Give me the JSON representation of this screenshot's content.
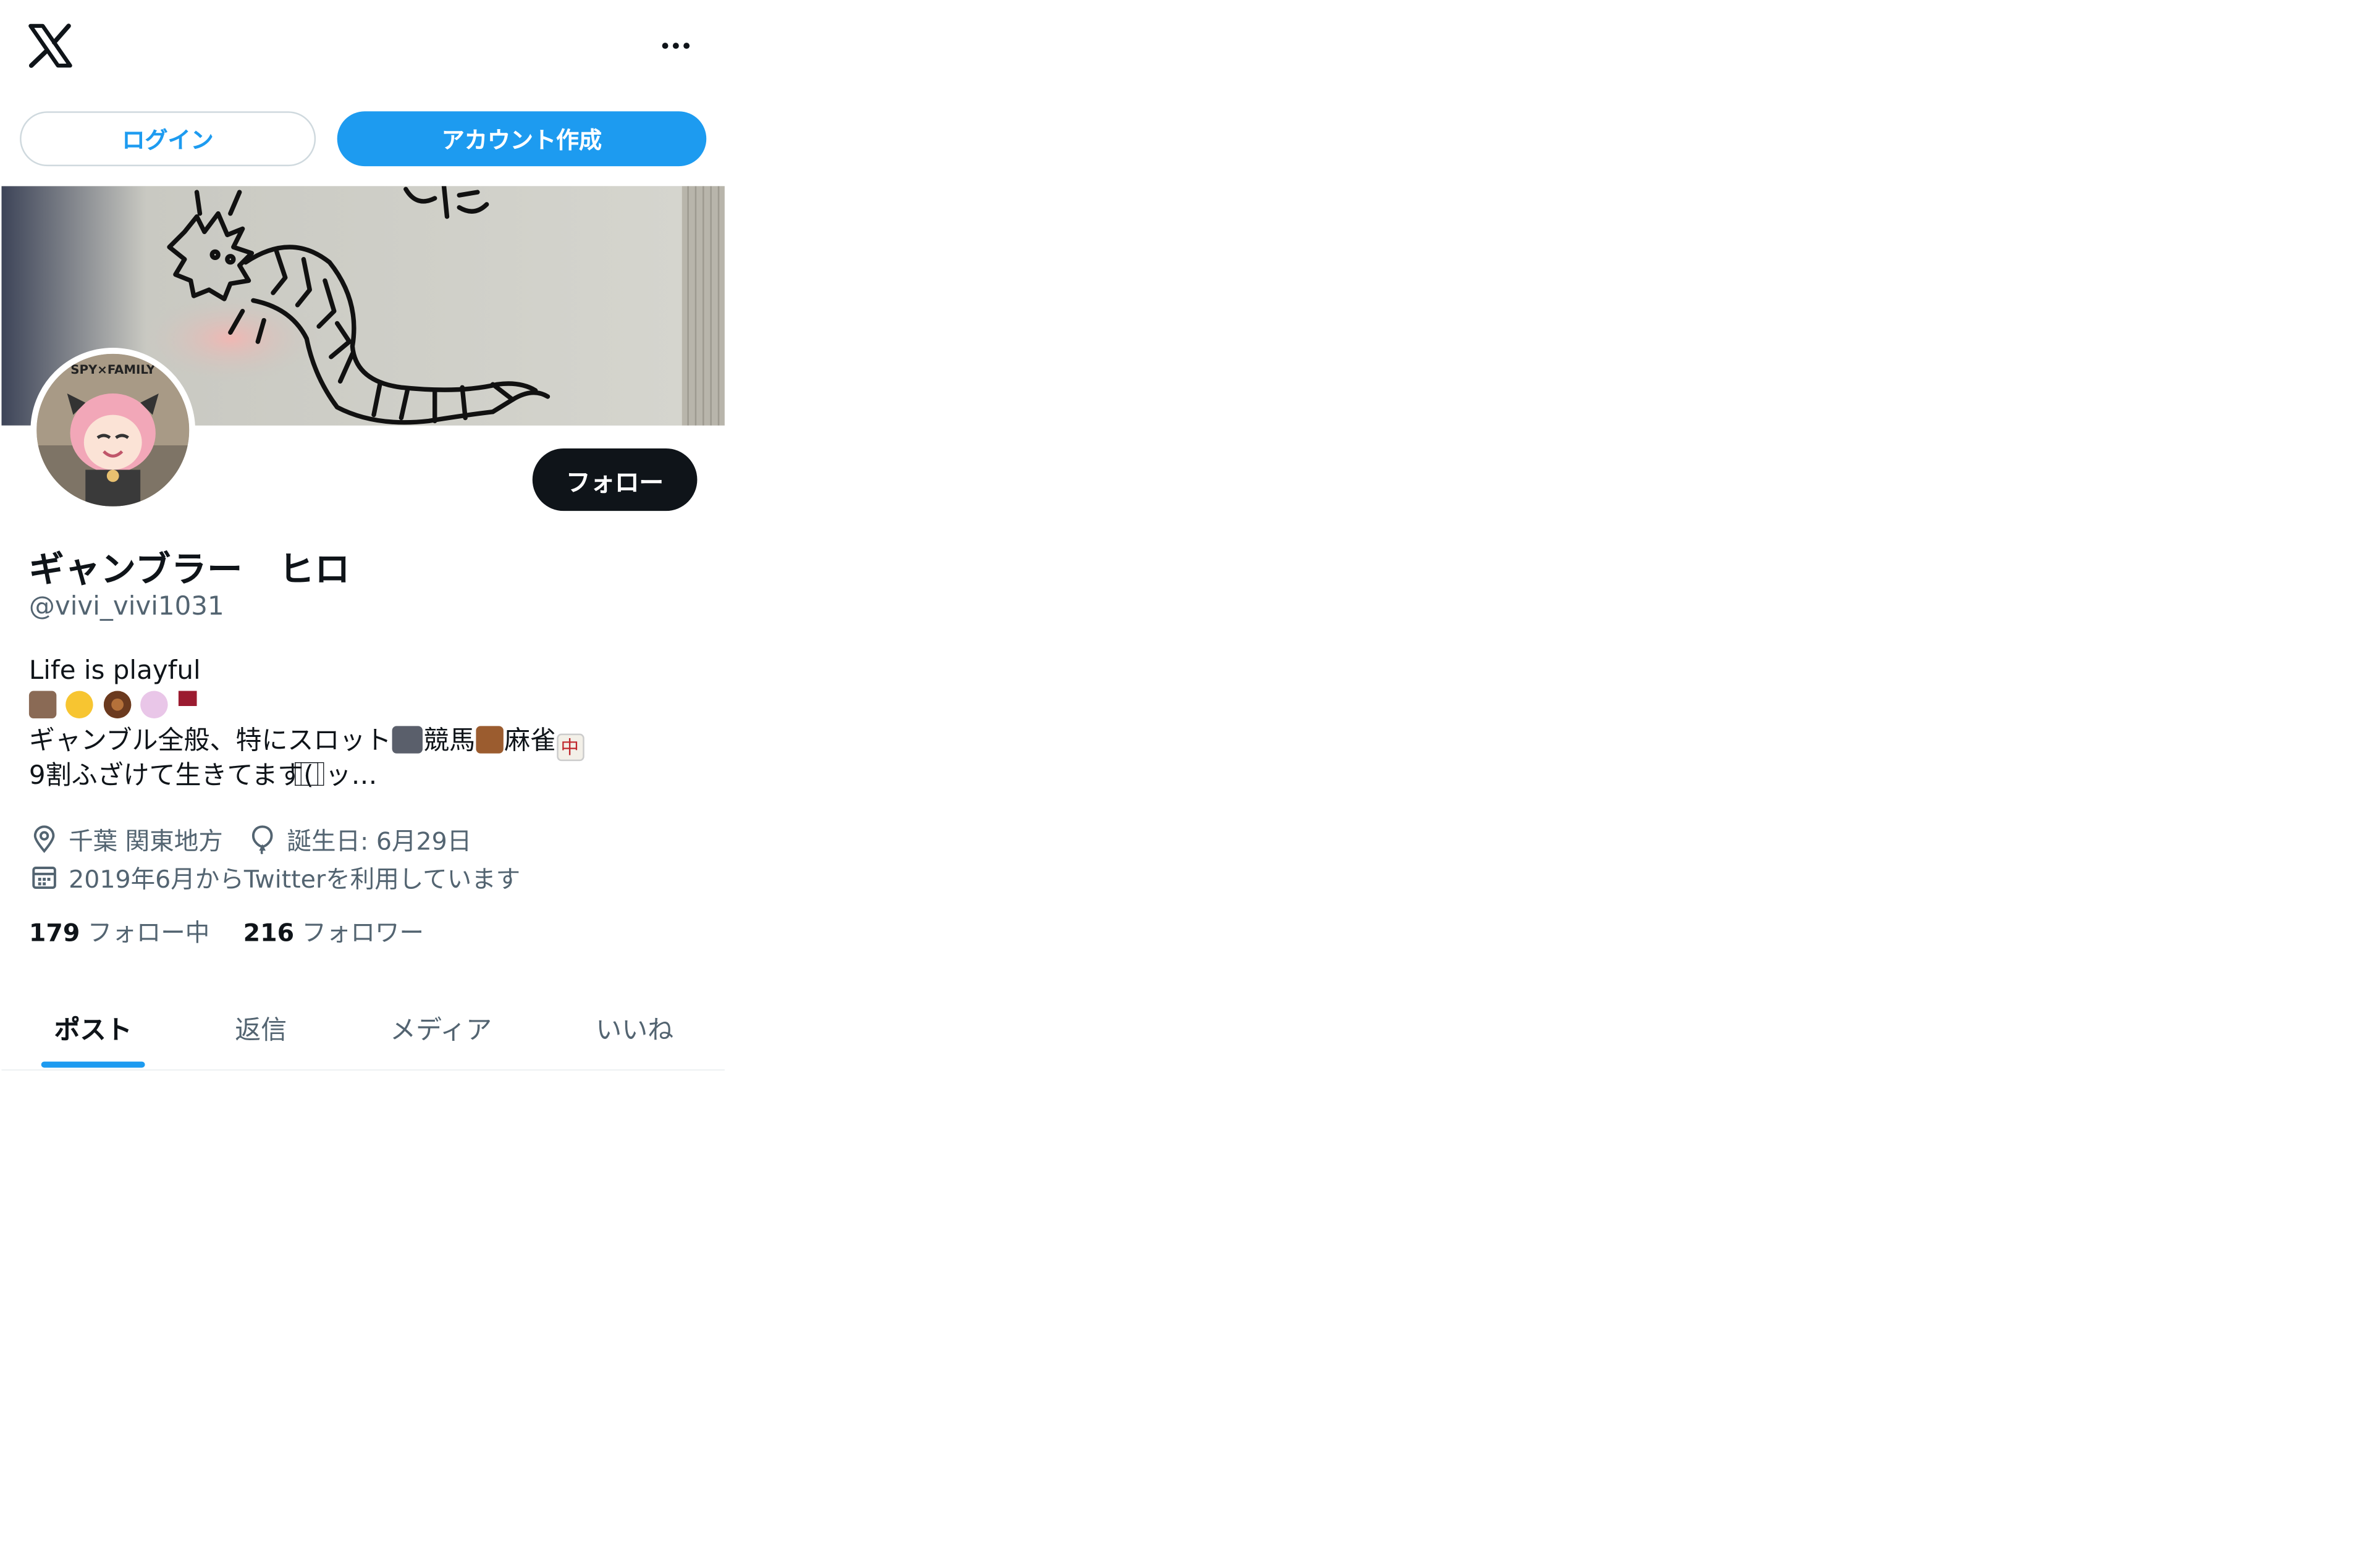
{
  "topbar": {
    "logo_icon": "x-logo-icon",
    "more_icon": "more-horizontal-icon"
  },
  "auth": {
    "login_label": "ログイン",
    "create_account_label": "アカウント作成"
  },
  "profile": {
    "avatar_text": "SPY×FAMILY",
    "follow_label": "フォロー",
    "display_name": "ギャンブラー　ヒロ",
    "handle": "@vivi_vivi1031",
    "bio": {
      "line1": "Life is playful",
      "line3_part1": "ギャンブル全般、特にスロット",
      "line3_part2": "競馬",
      "line3_part3": "麻雀",
      "line3_mahjong_tile": "中",
      "line4": "9割ふざけて生きてます(  ⃞⃞ ⃞ッ…"
    },
    "meta": {
      "location": "千葉 関東地方",
      "birthday": "誕生日: 6月29日",
      "joined": "2019年6月からTwitterを利用しています"
    },
    "counts": {
      "following_number": "179",
      "following_label": "フォロー中",
      "followers_number": "216",
      "followers_label": "フォロワー"
    }
  },
  "tabs": [
    {
      "label": "ポスト",
      "active": true
    },
    {
      "label": "返信",
      "active": false
    },
    {
      "label": "メディア",
      "active": false
    },
    {
      "label": "いいね",
      "active": false
    }
  ],
  "colors": {
    "accent": "#1d9bf0",
    "text_primary": "#0f1419",
    "text_secondary": "#536471"
  }
}
